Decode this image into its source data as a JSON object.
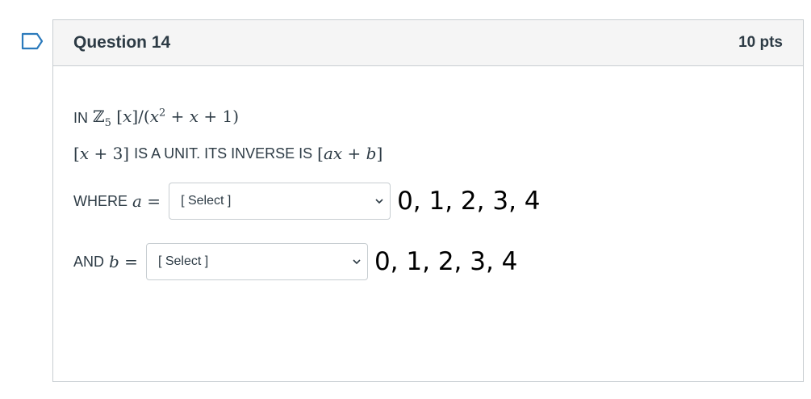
{
  "question": {
    "title": "Question 14",
    "points": "10 pts"
  },
  "body": {
    "line1_prefix": "IN",
    "line2_bracket": "x + 3",
    "line2_text": "IS A UNIT.  ITS INVERSE IS",
    "where_label": "WHERE",
    "and_label": "AND"
  },
  "select_a": {
    "value": "[ Select ]",
    "options_hint": "0, 1, 2, 3, 4"
  },
  "select_b": {
    "value": "[ Select ]",
    "options_hint": "0, 1, 2, 3, 4"
  },
  "colors": {
    "flag": "#2b7abc",
    "border": "#c7cdd1",
    "header_bg": "#f5f5f5",
    "text": "#2d3b45"
  },
  "icons": {
    "flag": "bookmark-flag-icon",
    "chevron": "chevron-down-icon"
  }
}
